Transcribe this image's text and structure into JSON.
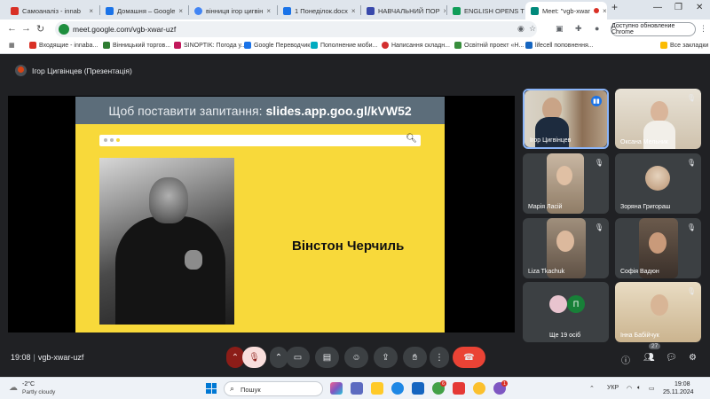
{
  "browser": {
    "tabs": [
      {
        "title": "Самоаналіз - innab",
        "favicon_color": "#d93025"
      },
      {
        "title": "Домашня – Google",
        "favicon_color": "#1a73e8"
      },
      {
        "title": "вінниця ігор цигвін",
        "favicon_color": "#4285f4"
      },
      {
        "title": "1 Понеділок.docx",
        "favicon_color": "#1a73e8"
      },
      {
        "title": "НАВЧАЛЬНИЙ ПОР",
        "favicon_color": "#3949ab"
      },
      {
        "title": "ENGLISH OPENS TH",
        "favicon_color": "#0f9d58"
      },
      {
        "title": "Meet: \"vgb-xwar",
        "favicon_color": "#00897b"
      }
    ],
    "new_tab": "+",
    "url": "meet.google.com/vgb-xwar-uzf",
    "update_label": "Доступно обновление Chrome",
    "bookmarks": [
      {
        "label": "Входящие - innaba...",
        "color": "#d93025"
      },
      {
        "label": "Вінницький торгов...",
        "color": "#2e7d32"
      },
      {
        "label": "SINOPTIK: Погода у...",
        "color": "#c2185b"
      },
      {
        "label": "Google Переводчик",
        "color": "#1a73e8"
      },
      {
        "label": "Пополнение моби...",
        "color": "#00acc1"
      },
      {
        "label": "Написання складн...",
        "color": "#d32f2f"
      },
      {
        "label": "Освітній проект «Н...",
        "color": "#388e3c"
      },
      {
        "label": "lifecell поповнення...",
        "color": "#1565c0"
      }
    ],
    "all_bookmarks": "Все закладки"
  },
  "meet": {
    "presenter_label": "Ігор Цигвінцев (Презентація)",
    "slide": {
      "header_prefix": "Щоб поставити запитання:",
      "header_link": "slides.app.goo.gl/kVW52",
      "caption": "Вінстон Черчиль"
    },
    "participants": [
      {
        "name": "Ігор Цигвінцев",
        "speaking": true
      },
      {
        "name": "Оксана Мельник"
      },
      {
        "name": "Марія Ласій"
      },
      {
        "name": "Зоряна Григораш"
      },
      {
        "name": "Liza Tkachuk"
      },
      {
        "name": "Софія Вадюн"
      },
      {
        "name": "Ще 19 осіб"
      },
      {
        "name": "Інна Бабійчук"
      }
    ],
    "more_avatar_letter": "П",
    "time": "19:08",
    "meeting_code": "vgb-xwar-uzf",
    "people_count": "27"
  },
  "taskbar": {
    "weather_temp": "-2°C",
    "weather_desc": "Partly cloudy",
    "search_label": "Пошук",
    "lang": "УКР",
    "time": "19:08",
    "date": "25.11.2024",
    "badge_a": "6",
    "badge_b": "1"
  },
  "colors": {
    "meet_bg": "#202124",
    "slide_yellow": "#f8d93a",
    "slide_header": "#5c6d7a",
    "end_call": "#ea4335",
    "active_tile_border": "#8ab4f8"
  }
}
